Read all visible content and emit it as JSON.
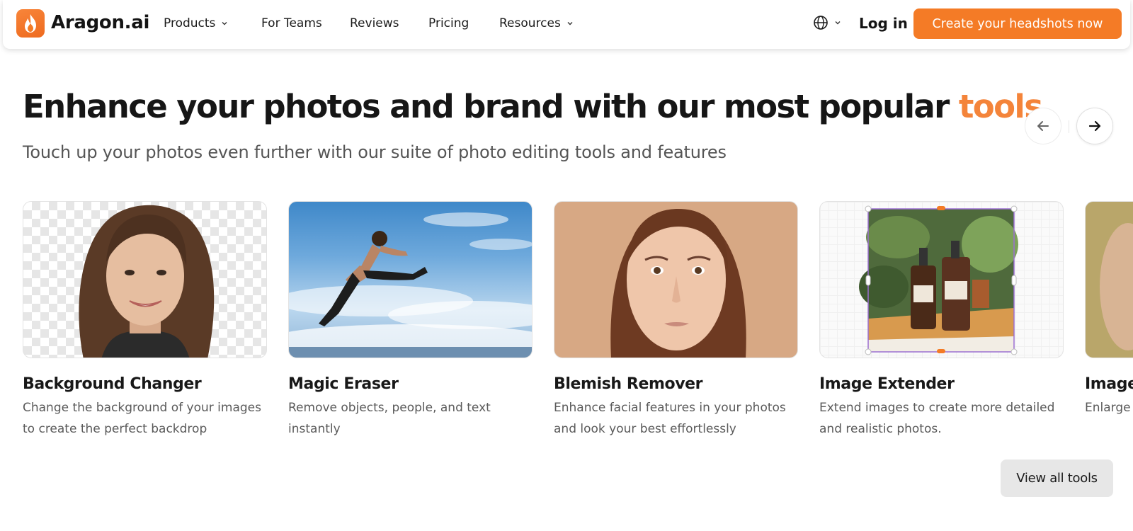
{
  "brand": {
    "name": "Aragon.ai",
    "accent": "#f47b26"
  },
  "nav": {
    "links": [
      {
        "label": "Products",
        "has_dropdown": true
      },
      {
        "label": "For Teams",
        "has_dropdown": false
      },
      {
        "label": "Reviews",
        "has_dropdown": false
      },
      {
        "label": "Pricing",
        "has_dropdown": false
      },
      {
        "label": "Resources",
        "has_dropdown": true
      }
    ],
    "language_icon": "globe-icon",
    "login_label": "Log in",
    "cta_label": "Create your headshots now"
  },
  "hero": {
    "headline_main": "Enhance your photos and brand with our most popular ",
    "headline_accent": "tools",
    "subheadline": "Touch up your photos even further with our suite of photo editing tools and features"
  },
  "carousel": {
    "prev_icon": "arrow-left-icon",
    "next_icon": "arrow-right-icon",
    "tools": [
      {
        "title": "Background Changer",
        "description": "Change the background of your images to create the perfect backdrop"
      },
      {
        "title": "Magic Eraser",
        "description": "Remove objects, people, and text instantly"
      },
      {
        "title": "Blemish Remover",
        "description": "Enhance facial features in your photos and look your best effortlessly"
      },
      {
        "title": "Image Extender",
        "description": "Extend images to create more detailed and realistic photos."
      },
      {
        "title": "Image",
        "description": "Enlarge i increase"
      }
    ]
  },
  "view_all_label": "View all tools"
}
